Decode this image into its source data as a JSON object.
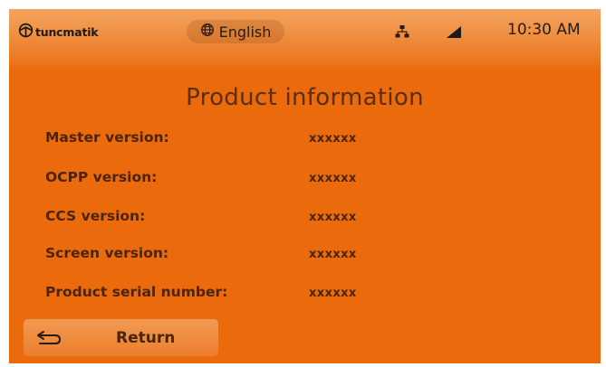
{
  "header": {
    "brand": "tuncmatik",
    "language": "English",
    "time": "10:30 AM",
    "icons": {
      "logo": "tuncmatik-logo-icon",
      "language": "globe-icon",
      "network": "network-icon",
      "signal": "signal-icon"
    }
  },
  "page": {
    "title": "Product information"
  },
  "info": [
    {
      "label": "Master version:",
      "value": "xxxxxx"
    },
    {
      "label": "OCPP version:",
      "value": "xxxxxx"
    },
    {
      "label": "CCS version:",
      "value": "xxxxxx"
    },
    {
      "label": "Screen version:",
      "value": "xxxxxx"
    },
    {
      "label": "Product serial number:",
      "value": "xxxxxx"
    }
  ],
  "footer": {
    "return_label": "Return",
    "return_icon": "return-arrow-icon"
  },
  "colors": {
    "background": "#ea6a0c",
    "text": "#4b2409",
    "button": "#ee8a3a"
  }
}
